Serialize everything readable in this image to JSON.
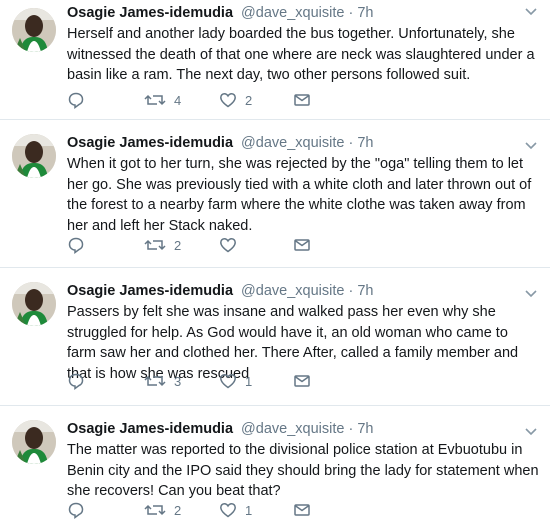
{
  "tweets": [
    {
      "name": "Osagie James-idemudia",
      "handle": "@dave_xquisite",
      "dot": "·",
      "time": "7h",
      "text": "Herself and another lady boarded the bus together. Unfortunately, she witnessed the death of that one where are neck was slaughtered under a basin like a ram. The next day, two other persons followed suit.",
      "retweets": "4",
      "likes": "2",
      "avatar_icon": "profile-photo"
    },
    {
      "name": "Osagie James-idemudia",
      "handle": "@dave_xquisite",
      "dot": "·",
      "time": "7h",
      "text": "When it got to her turn, she was rejected by the \"oga\" telling them to let her go. She was previously tied with a white cloth and later thrown out of the forest to a nearby farm where the white clothe was taken away from her and left her Stack naked.",
      "retweets": "2",
      "likes": "",
      "avatar_icon": "profile-photo"
    },
    {
      "name": "Osagie James-idemudia",
      "handle": "@dave_xquisite",
      "dot": "·",
      "time": "7h",
      "text": "Passers by felt she was insane and walked pass her even why she struggled for help. As God would have it,  an old woman who came to farm saw her and clothed her. There After, called a family member and that is how she was rescued",
      "retweets": "3",
      "likes": "1",
      "avatar_icon": "profile-photo"
    },
    {
      "name": "Osagie James-idemudia",
      "handle": "@dave_xquisite",
      "dot": "·",
      "time": "7h",
      "text": "The matter was reported to the divisional police station at Evbuotubu in Benin city and the IPO said they should bring the lady for statement when she recovers! Can you beat that?",
      "retweets": "2",
      "likes": "1",
      "avatar_icon": "profile-photo"
    }
  ],
  "icons": {
    "reply": "reply-icon",
    "retweet": "retweet-icon",
    "like": "heart-icon",
    "message": "envelope-icon",
    "menu": "chevron-down-icon"
  },
  "colors": {
    "text": "#14171a",
    "secondary": "#657786",
    "divider": "#e1e8ed",
    "icon": "#657786"
  }
}
